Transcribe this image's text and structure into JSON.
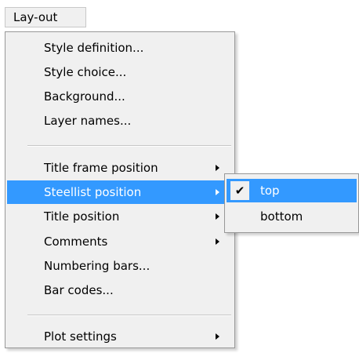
{
  "menubar": {
    "title": "Lay-out"
  },
  "menu": {
    "items": [
      {
        "label": "Style definition..."
      },
      {
        "label": "Style choice..."
      },
      {
        "label": "Background..."
      },
      {
        "label": "Layer names..."
      },
      {
        "label": "Title frame position"
      },
      {
        "label": "Steellist position",
        "state": "highlighted"
      },
      {
        "label": "Title position"
      },
      {
        "label": "Comments"
      },
      {
        "label": "Numbering bars..."
      },
      {
        "label": "Bar codes..."
      },
      {
        "label": "Plot settings"
      }
    ]
  },
  "submenu": {
    "items": [
      {
        "label": "top",
        "checked": true,
        "check_glyph": "✔"
      },
      {
        "label": "bottom",
        "checked": false
      }
    ]
  },
  "colors": {
    "highlight": "#3399ff",
    "menu_bg": "#f0f0f0"
  }
}
